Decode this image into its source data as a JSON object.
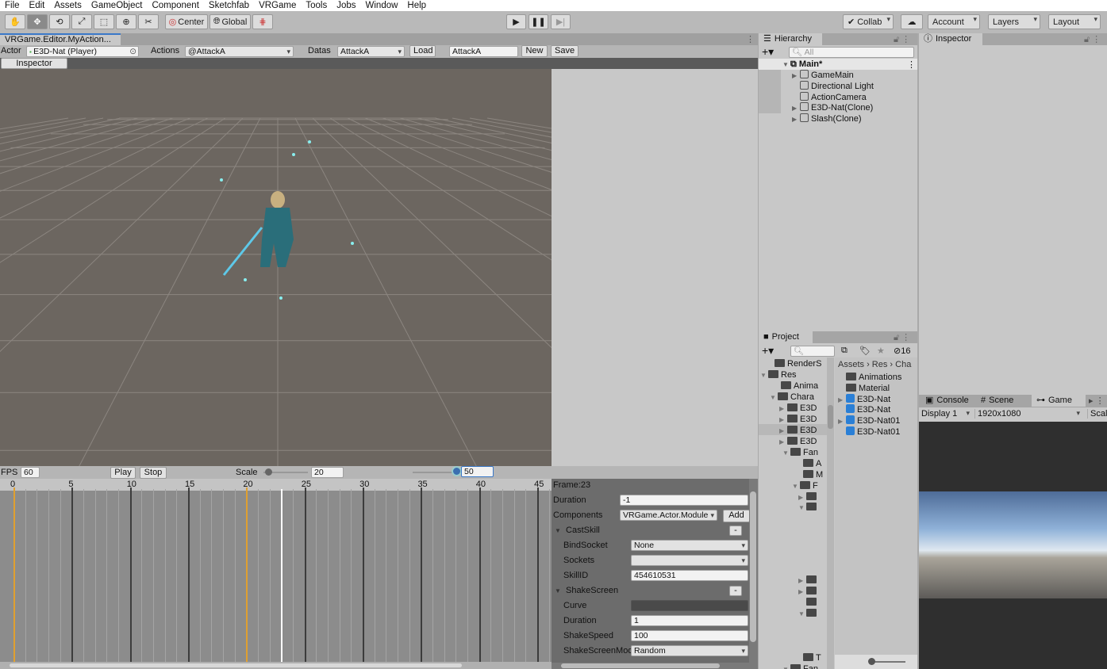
{
  "menu": [
    "File",
    "Edit",
    "Assets",
    "GameObject",
    "Component",
    "Sketchfab",
    "VRGame",
    "Tools",
    "Jobs",
    "Window",
    "Help"
  ],
  "toolbar": {
    "tools": [
      "hand-icon",
      "move-icon",
      "rotate-icon",
      "scale-icon",
      "rect-icon",
      "transform-icon",
      "custom-tool-icon"
    ],
    "pivot": "Center",
    "space": "Global",
    "collab": "Collab",
    "account": "Account",
    "layers": "Layers",
    "layout": "Layout"
  },
  "editor": {
    "tab": "VRGame.Editor.MyAction...",
    "actor_label": "Actor",
    "actor_value": "E3D-Nat (Player)",
    "actions_label": "Actions",
    "actions_value": "@AttackA",
    "datas_label": "Datas",
    "datas_value": "AttackA",
    "load": "Load",
    "name_value": "AttackA",
    "new": "New",
    "save": "Save",
    "inspector_btn": "Inspector"
  },
  "playback": {
    "fps_label": "FPS",
    "fps": "60",
    "play": "Play",
    "stop": "Stop",
    "scale_label": "Scale",
    "scale": "20",
    "frames": "50",
    "scale_slider": 0.1,
    "frames_slider": 1.0
  },
  "timeline": {
    "ticks": [
      "0",
      "5",
      "10",
      "15",
      "20",
      "25",
      "30",
      "35",
      "40",
      "45"
    ],
    "markers": [
      0,
      20
    ],
    "current_frame": 23,
    "marker_color": "#e0a030",
    "current_color": "#ffffff"
  },
  "frame_panel": {
    "title": "Frame:23",
    "duration_label": "Duration",
    "duration": "-1",
    "components_label": "Components",
    "components_value": "VRGame.Actor.Module",
    "add": "Add",
    "groups": [
      {
        "name": "CastSkill",
        "remove": "-",
        "fields": [
          {
            "label": "BindSocket",
            "value": "None",
            "type": "dropdown"
          },
          {
            "label": "Sockets",
            "value": "",
            "type": "dropdown"
          },
          {
            "label": "SkillID",
            "value": "454610531",
            "type": "text"
          }
        ]
      },
      {
        "name": "ShakeScreen",
        "remove": "-",
        "fields": [
          {
            "label": "Curve",
            "value": "",
            "type": "curve"
          },
          {
            "label": "Duration",
            "value": "1",
            "type": "text"
          },
          {
            "label": "ShakeSpeed",
            "value": "100",
            "type": "text"
          },
          {
            "label": "ShakeScreenMode",
            "value": "Random",
            "type": "dropdown"
          }
        ]
      }
    ]
  },
  "hierarchy": {
    "title": "Hierarchy",
    "search_placeholder": "All",
    "scene": "Main*",
    "items": [
      {
        "name": "GameMain",
        "expandable": true
      },
      {
        "name": "Directional Light",
        "expandable": false
      },
      {
        "name": "ActionCamera",
        "expandable": false
      },
      {
        "name": "E3D-Nat(Clone)",
        "expandable": true
      },
      {
        "name": "Slash(Clone)",
        "expandable": true
      }
    ]
  },
  "inspector": {
    "title": "Inspector"
  },
  "project": {
    "title": "Project",
    "hidden_count": "16",
    "breadcrumb": [
      "Assets",
      "Res",
      "Cha"
    ],
    "tree": [
      "RenderS",
      "Res",
      "Anima",
      "Chara",
      "E3D",
      "E3D",
      "E3D",
      "E3D",
      "Fan",
      "A",
      "M",
      "F",
      "",
      "",
      "",
      "",
      "",
      "",
      "T",
      "Fan"
    ],
    "assets": [
      {
        "name": "Animations",
        "icon": "folder"
      },
      {
        "name": "Material",
        "icon": "folder"
      },
      {
        "name": "E3D-Nat",
        "icon": "prefab-model"
      },
      {
        "name": "E3D-Nat",
        "icon": "prefab"
      },
      {
        "name": "E3D-Nat01",
        "icon": "prefab-model"
      },
      {
        "name": "E3D-Nat01",
        "icon": "prefab"
      }
    ]
  },
  "game": {
    "tabs": [
      "Console",
      "Scene",
      "Game"
    ],
    "display": "Display 1",
    "resolution": "1920x1080",
    "scale": "Scale"
  }
}
